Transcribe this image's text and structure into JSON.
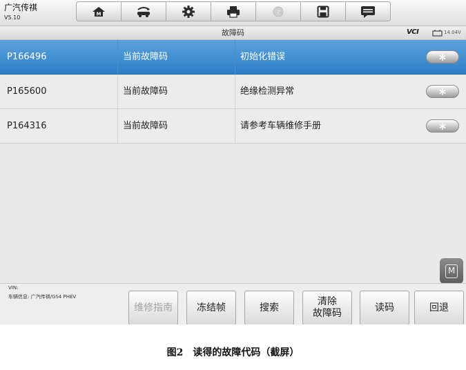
{
  "app": {
    "title": "广汽传祺",
    "version": "V5.10"
  },
  "toolbar": {
    "buttons": [
      {
        "icon": "home-icon",
        "enabled": true
      },
      {
        "icon": "vehicle-swap-icon",
        "enabled": true
      },
      {
        "icon": "gear-icon",
        "enabled": true
      },
      {
        "icon": "printer-icon",
        "enabled": true
      },
      {
        "icon": "help-icon",
        "enabled": false
      },
      {
        "icon": "save-icon",
        "enabled": true
      },
      {
        "icon": "message-icon",
        "enabled": true
      }
    ]
  },
  "subbar": {
    "title": "故障码",
    "vci": "VCI",
    "voltage": "14.04V"
  },
  "codes": [
    {
      "code": "P166496",
      "status": "当前故障码",
      "description": "初始化错误",
      "selected": true
    },
    {
      "code": "P165600",
      "status": "当前故障码",
      "description": "绝缘检测异常",
      "selected": false
    },
    {
      "code": "P164316",
      "status": "当前故障码",
      "description": "请参考车辆维修手册",
      "selected": false
    }
  ],
  "floating": {
    "label": "M"
  },
  "footer": {
    "vin_label": "VIN:",
    "vehicle_info": "车辆信息: 广汽传祺/GS4 PHEV",
    "buttons": {
      "repair_guide": "维修指南",
      "freeze_frame": "冻结帧",
      "search": "搜索",
      "clear_line1": "清除",
      "clear_line2": "故障码",
      "read_codes": "读码",
      "back": "回退"
    }
  },
  "caption": "图2　读得的故障代码（截屏）",
  "colors": {
    "selected_row": "#3d8ad0",
    "background": "#e9e9ea"
  }
}
